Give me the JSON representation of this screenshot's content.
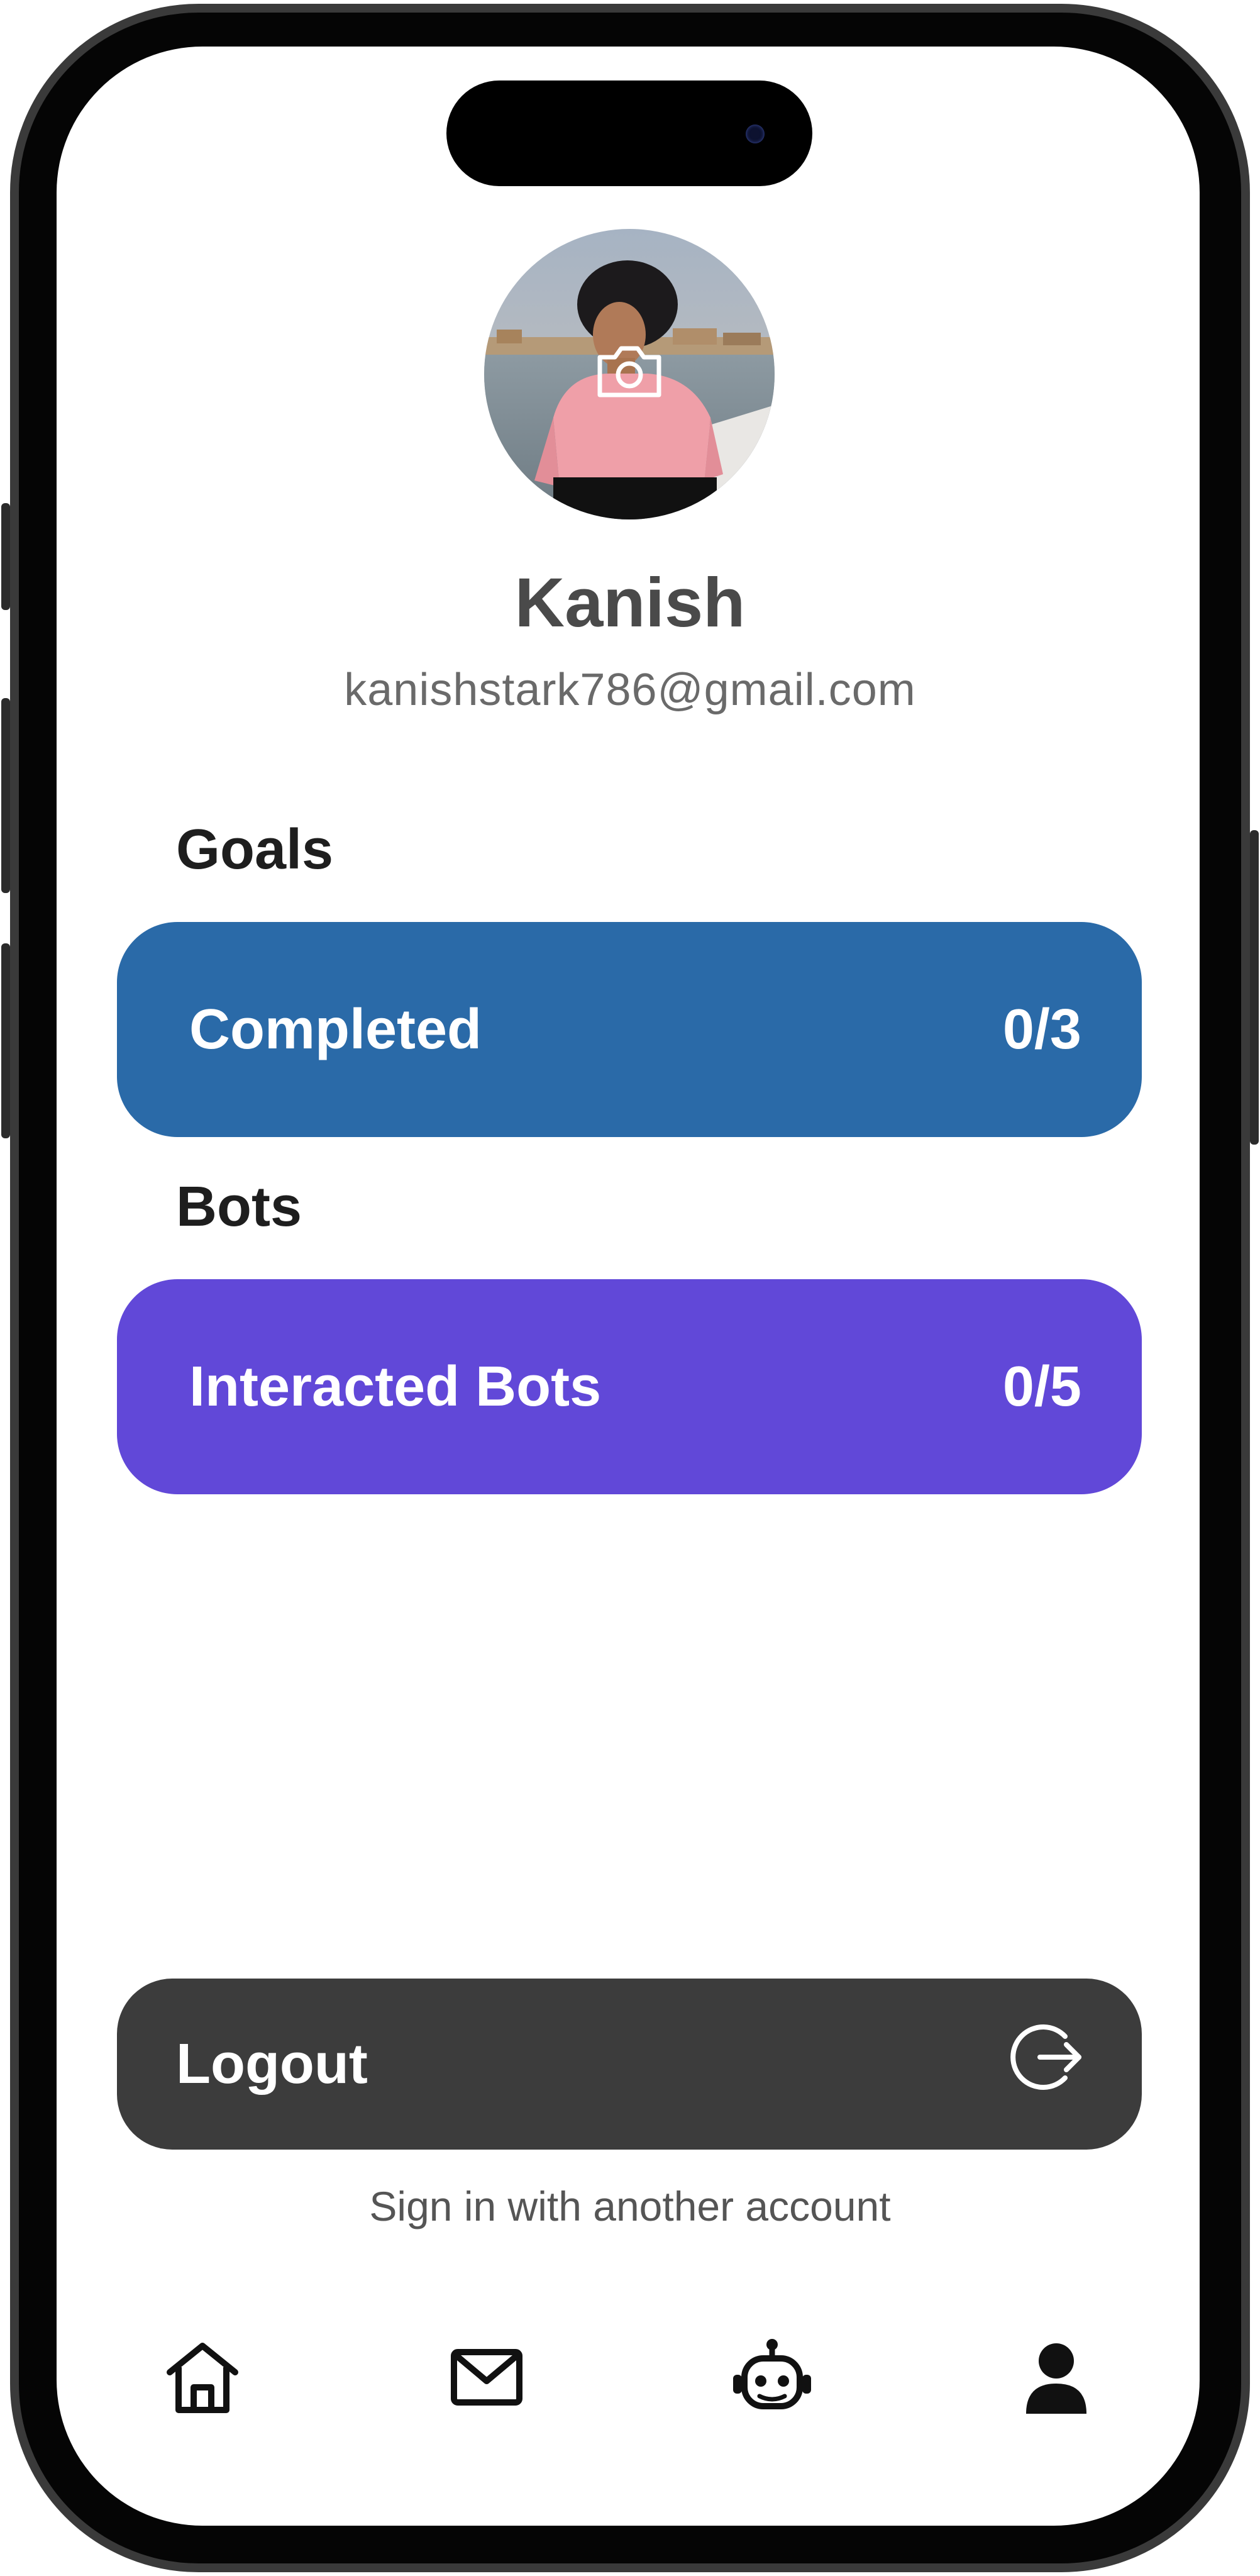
{
  "profile": {
    "name": "Kanish",
    "email": "kanishstark786@gmail.com"
  },
  "goals": {
    "heading": "Goals",
    "label": "Completed",
    "value": "0/3",
    "color": "#2a6aa8"
  },
  "bots": {
    "heading": "Bots",
    "label": "Interacted Bots",
    "value": "0/5",
    "color": "#6148d8"
  },
  "logout": {
    "label": "Logout",
    "icon": "logout-icon",
    "color": "#3c3c3c"
  },
  "switch_account": "Sign in with another account",
  "nav": {
    "items": [
      {
        "icon": "home-icon",
        "active": false
      },
      {
        "icon": "mail-icon",
        "active": false
      },
      {
        "icon": "bot-icon",
        "active": false
      },
      {
        "icon": "profile-icon",
        "active": true
      }
    ]
  }
}
